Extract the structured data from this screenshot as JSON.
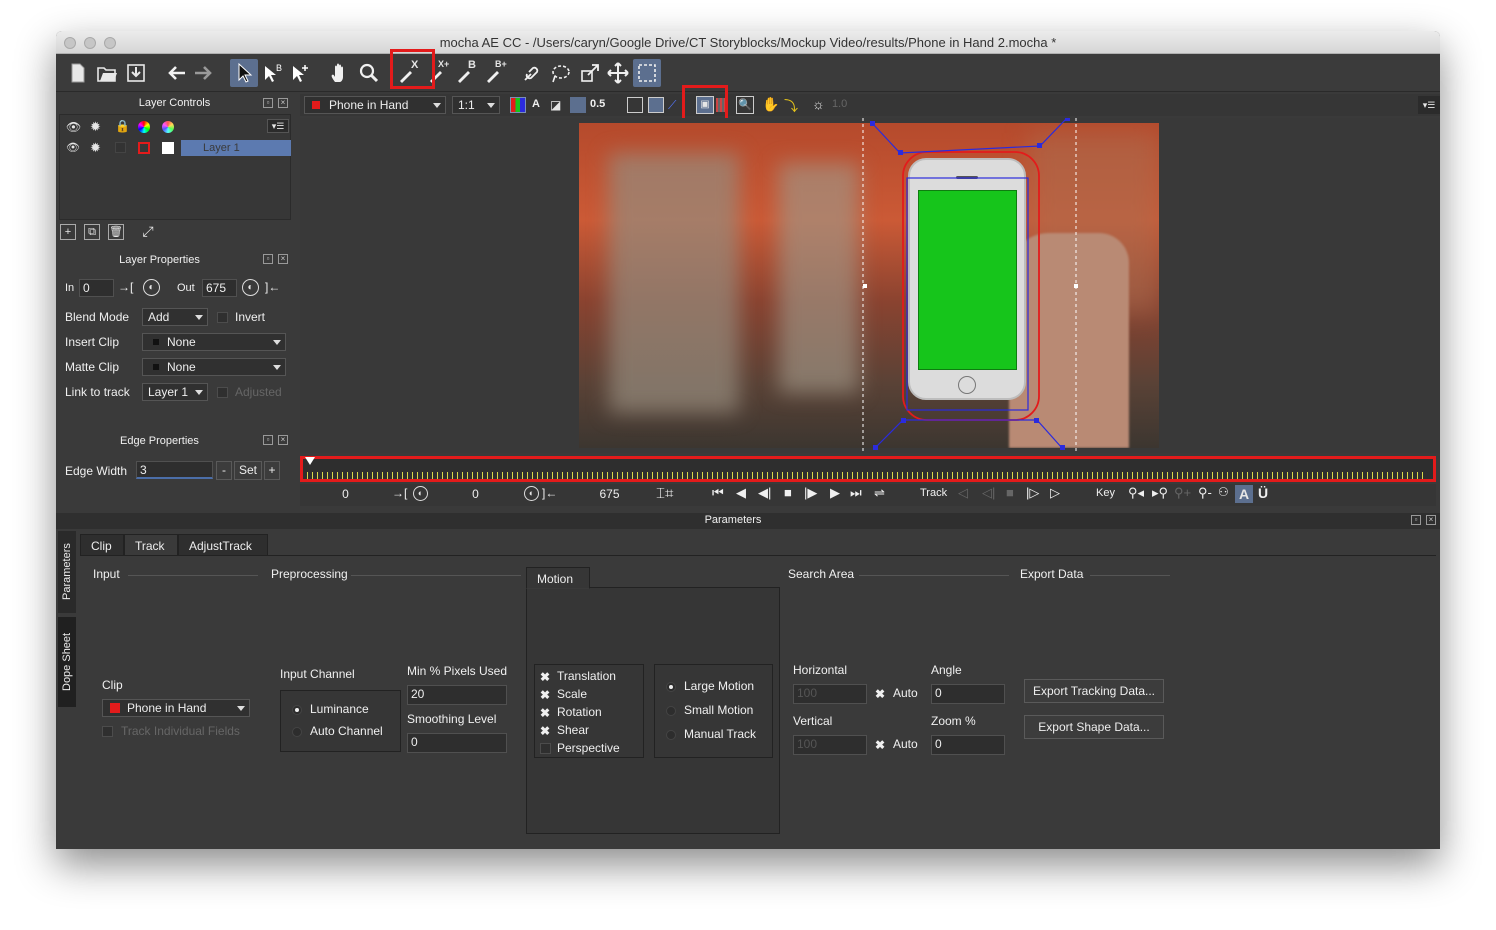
{
  "window": {
    "title": "mocha AE CC - /Users/caryn/Google Drive/CT Storyblocks/Mockup Video/results/Phone in Hand 2.mocha *"
  },
  "toolbar": {
    "tools": [
      "new-file-icon",
      "open-folder-icon",
      "save-icon",
      "undo-arrow-icon",
      "redo-arrow-icon",
      "pick-tool-icon",
      "pick-bspline-tool-icon",
      "add-point-tool-icon",
      "hand-pan-icon",
      "zoom-icon",
      "create-x-spline-icon",
      "add-x-spline-icon",
      "create-b-spline-icon",
      "add-b-spline-icon",
      "link-icon",
      "lasso-icon",
      "scale-transform-icon",
      "move-transform-icon",
      "surface-select-icon"
    ],
    "labels": {
      "x": "X",
      "xplus": "X+",
      "b": "B",
      "bplus": "B+"
    }
  },
  "layer_controls": {
    "title": "Layer Controls",
    "layers": [
      {
        "name": "Layer 1"
      }
    ]
  },
  "viewer_bar": {
    "clip": "Phone in Hand",
    "zoom": "1:1",
    "alpha_label": "A",
    "opacity": "0.5",
    "exposure": "1.0"
  },
  "layer_properties": {
    "title": "Layer Properties",
    "in_label": "In",
    "in_value": "0",
    "out_label": "Out",
    "out_value": "675",
    "blend_mode_label": "Blend Mode",
    "blend_mode_value": "Add",
    "invert_label": "Invert",
    "insert_clip_label": "Insert Clip",
    "insert_clip_value": "None",
    "matte_clip_label": "Matte Clip",
    "matte_clip_value": "None",
    "link_track_label": "Link to track",
    "link_track_value": "Layer 1",
    "adjusted_label": "Adjusted"
  },
  "edge_properties": {
    "title": "Edge Properties",
    "edge_width_label": "Edge Width",
    "edge_width_value": "3",
    "minus": "-",
    "set": "Set",
    "plus": "+"
  },
  "timeline": {
    "start": "0",
    "in": "0",
    "out": "675",
    "track_label": "Track",
    "key_label": "Key",
    "a_label": "A",
    "u_label": "Ü"
  },
  "parameters": {
    "title": "Parameters",
    "side_tabs": [
      "Parameters",
      "Dope Sheet"
    ],
    "tabs": [
      "Clip",
      "Track",
      "AdjustTrack"
    ],
    "active_tab": "Track",
    "sections": {
      "input": "Input",
      "preprocessing": "Preprocessing",
      "motion": "Motion",
      "search_area": "Search Area",
      "export_data": "Export Data"
    },
    "clip_label": "Clip",
    "clip_value": "Phone in Hand",
    "track_individual_fields": "Track Individual Fields",
    "input_channel_label": "Input Channel",
    "channels": [
      "Luminance",
      "Auto Channel"
    ],
    "min_pixels_label": "Min % Pixels Used",
    "min_pixels_value": "20",
    "smoothing_label": "Smoothing Level",
    "smoothing_value": "0",
    "motion_options": [
      "Translation",
      "Scale",
      "Rotation",
      "Shear",
      "Perspective"
    ],
    "motion_modes": [
      "Large Motion",
      "Small Motion",
      "Manual Track"
    ],
    "horizontal_label": "Horizontal",
    "horizontal_value": "100",
    "vertical_label": "Vertical",
    "vertical_value": "100",
    "auto_label": "Auto",
    "angle_label": "Angle",
    "angle_value": "0",
    "zoom_label": "Zoom %",
    "zoom_value": "0",
    "export_tracking": "Export Tracking Data...",
    "export_shape": "Export Shape Data..."
  },
  "colors": {
    "accent_red": "#e31b1b",
    "green_screen": "#16c51b",
    "selection_blue": "#5c6f8f",
    "spline_blue": "#2b2bdd"
  }
}
